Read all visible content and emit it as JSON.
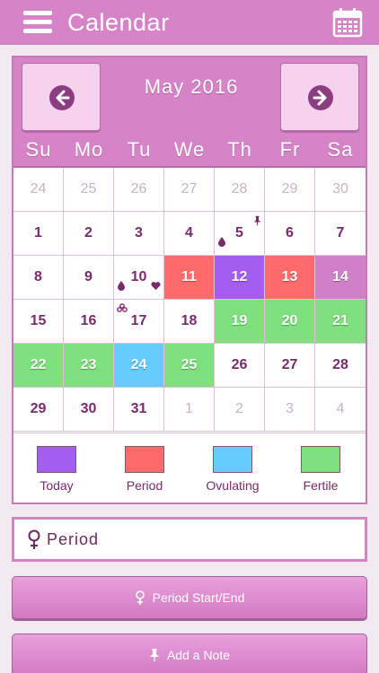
{
  "app": {
    "title": "Calendar"
  },
  "calendar": {
    "month_title": "May 2016",
    "weekdays": [
      "Su",
      "Mo",
      "Tu",
      "We",
      "Th",
      "Fr",
      "Sa"
    ],
    "days": [
      {
        "day": "24",
        "state": "other"
      },
      {
        "day": "25",
        "state": "other"
      },
      {
        "day": "26",
        "state": "other"
      },
      {
        "day": "27",
        "state": "other"
      },
      {
        "day": "28",
        "state": "other"
      },
      {
        "day": "29",
        "state": "other"
      },
      {
        "day": "30",
        "state": "other"
      },
      {
        "day": "1",
        "state": "normal"
      },
      {
        "day": "2",
        "state": "normal"
      },
      {
        "day": "3",
        "state": "normal"
      },
      {
        "day": "4",
        "state": "normal"
      },
      {
        "day": "5",
        "state": "normal",
        "marks": [
          "drop-icon",
          "pin-icon"
        ]
      },
      {
        "day": "6",
        "state": "normal"
      },
      {
        "day": "7",
        "state": "normal"
      },
      {
        "day": "8",
        "state": "normal"
      },
      {
        "day": "9",
        "state": "normal"
      },
      {
        "day": "10",
        "state": "normal",
        "marks": [
          "drop-icon",
          "heart-icon"
        ]
      },
      {
        "day": "11",
        "state": "period"
      },
      {
        "day": "12",
        "state": "today"
      },
      {
        "day": "13",
        "state": "period"
      },
      {
        "day": "14",
        "state": "highlight"
      },
      {
        "day": "15",
        "state": "normal"
      },
      {
        "day": "16",
        "state": "normal"
      },
      {
        "day": "17",
        "state": "normal",
        "marks": [
          "pills-icon"
        ]
      },
      {
        "day": "18",
        "state": "normal"
      },
      {
        "day": "19",
        "state": "fertile"
      },
      {
        "day": "20",
        "state": "fertile"
      },
      {
        "day": "21",
        "state": "fertile"
      },
      {
        "day": "22",
        "state": "fertile"
      },
      {
        "day": "23",
        "state": "fertile"
      },
      {
        "day": "24",
        "state": "ovulating"
      },
      {
        "day": "25",
        "state": "fertile"
      },
      {
        "day": "26",
        "state": "normal"
      },
      {
        "day": "27",
        "state": "normal"
      },
      {
        "day": "28",
        "state": "normal"
      },
      {
        "day": "29",
        "state": "normal"
      },
      {
        "day": "30",
        "state": "normal"
      },
      {
        "day": "31",
        "state": "normal"
      },
      {
        "day": "1",
        "state": "other"
      },
      {
        "day": "2",
        "state": "other"
      },
      {
        "day": "3",
        "state": "other"
      },
      {
        "day": "4",
        "state": "other"
      }
    ]
  },
  "legend": [
    {
      "label": "Today",
      "color": "#a35ef0"
    },
    {
      "label": "Period",
      "color": "#ff6b6b"
    },
    {
      "label": "Ovulating",
      "color": "#66ccff"
    },
    {
      "label": "Fertile",
      "color": "#7ee07e"
    }
  ],
  "selected": {
    "label": "Period",
    "icon": "venus-icon"
  },
  "actions": {
    "period_button": "Period Start/End",
    "note_button": "Add a Note"
  },
  "colors": {
    "header": "#d783c7",
    "accent_text": "#7a2a6b"
  }
}
